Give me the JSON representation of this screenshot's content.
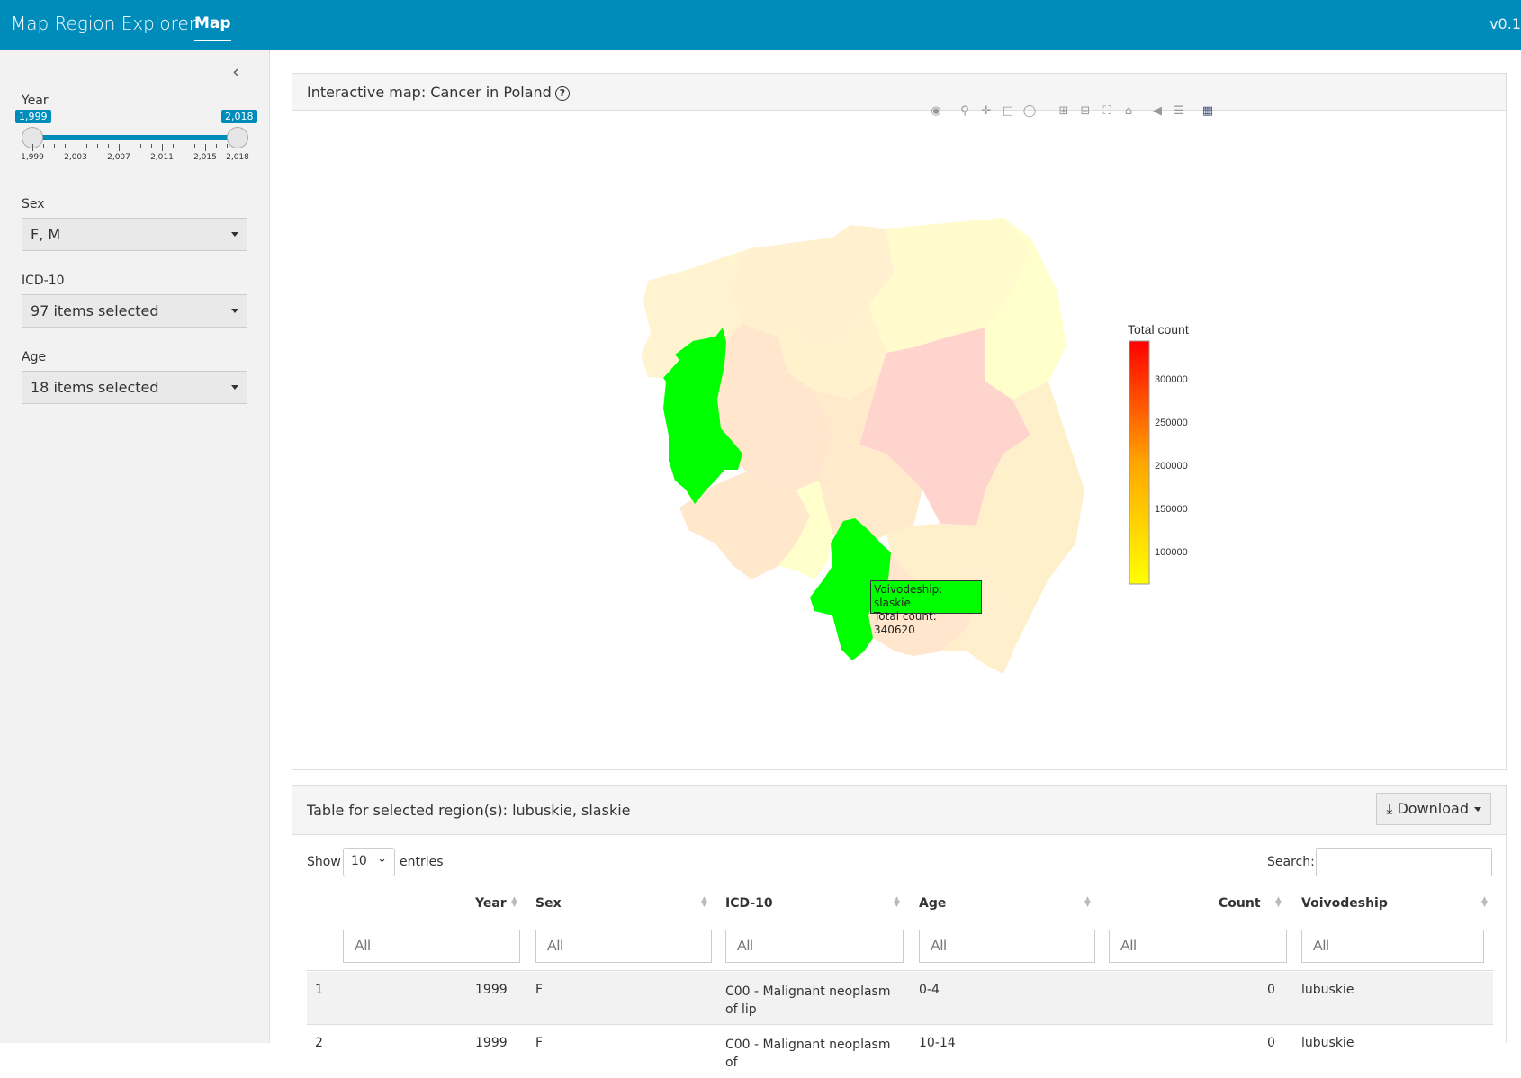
{
  "app": {
    "brand": "Map Region Explorer",
    "tab": "Map",
    "version": "v0.1"
  },
  "sidebar": {
    "collapse_icon": "chevron-left-icon",
    "year": {
      "label": "Year",
      "from_badge": "1,999",
      "to_badge": "2,018",
      "from": 1999,
      "to": 2018,
      "tick_labels": [
        "1,999",
        "2,003",
        "2,007",
        "2,011",
        "2,015",
        "2,018"
      ]
    },
    "sex": {
      "label": "Sex",
      "value": "F, M"
    },
    "icd10": {
      "label": "ICD-10",
      "value": "97 items selected"
    },
    "age": {
      "label": "Age",
      "value": "18 items selected"
    }
  },
  "map_panel": {
    "title": "Interactive map: Cancer in Poland",
    "help_icon": "question-circle-icon",
    "toolbar": [
      "camera-icon",
      "zoom-icon",
      "pan-icon",
      "box-select-icon",
      "lasso-select-icon",
      "zoom-in-icon",
      "zoom-out-icon",
      "autoscale-icon",
      "reset-icon",
      "hover-closest-icon",
      "hover-compare-icon",
      "plotly-logo-icon"
    ],
    "tooltip": {
      "line1": "Voivodeship: slaskie",
      "line2": "Total count: 340620"
    },
    "colorbar": {
      "title": "Total count",
      "ticks": [
        "300000",
        "250000",
        "200000",
        "150000",
        "100000"
      ]
    }
  },
  "chart_data": {
    "type": "choropleth",
    "title": "Interactive map: Cancer in Poland",
    "colorscale": [
      "#ffff00",
      "#ff0000"
    ],
    "legend_title": "Total count",
    "colorbar_ticks": [
      100000,
      150000,
      200000,
      250000,
      300000
    ],
    "highlight_color": "#00ff00",
    "selected_regions": [
      "lubuskie",
      "slaskie"
    ],
    "values": [
      {
        "region": "slaskie",
        "value": 340620
      }
    ]
  },
  "table_panel": {
    "title": "Table for selected region(s): lubuskie, slaskie",
    "download_label": "Download",
    "download_icon": "download-icon",
    "show_label": "Show",
    "entries_value": "10",
    "entries_label": "entries",
    "search_label": "Search:",
    "columns": [
      "Year",
      "Sex",
      "ICD-10",
      "Age",
      "Count",
      "Voivodeship"
    ],
    "filter_placeholder": "All",
    "rows": [
      [
        "1",
        "1999",
        "F",
        "C00 - Malignant neoplasm of lip",
        "0-4",
        "0",
        "lubuskie"
      ],
      [
        "2",
        "1999",
        "F",
        "C00 - Malignant neoplasm of",
        "10-14",
        "0",
        "lubuskie"
      ]
    ]
  }
}
